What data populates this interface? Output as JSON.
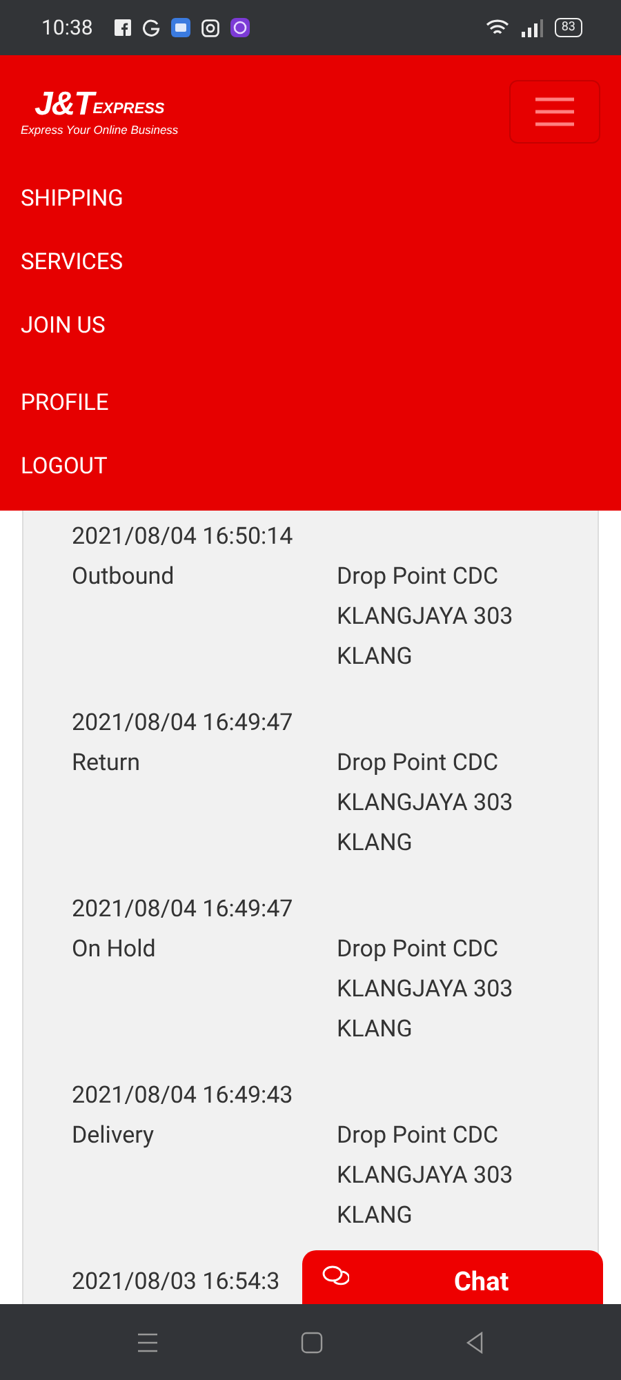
{
  "status_bar": {
    "time": "10:38",
    "battery": "83"
  },
  "header": {
    "logo": {
      "brand": "J&T",
      "suffix": "EXPRESS",
      "tagline": "Express Your Online Business"
    }
  },
  "nav_groups": [
    [
      "SHIPPING",
      "SERVICES",
      "JOIN US"
    ],
    [
      "PROFILE",
      "LOGOUT"
    ]
  ],
  "tracking": [
    {
      "datetime": "2021/08/04 16:50:14",
      "status": "Outbound",
      "location": "Drop Point CDC KLANGJAYA 303 KLANG"
    },
    {
      "datetime": "2021/08/04 16:49:47",
      "status": "Return",
      "location": "Drop Point CDC KLANGJAYA 303 KLANG"
    },
    {
      "datetime": "2021/08/04 16:49:47",
      "status": "On Hold",
      "location": "Drop Point CDC KLANGJAYA 303 KLANG"
    },
    {
      "datetime": "2021/08/04 16:49:43",
      "status": "Delivery",
      "location": "Drop Point CDC KLANGJAYA 303 KLANG"
    },
    {
      "datetime": "2021/08/03 16:54:3"
    }
  ],
  "chat_button": {
    "label": "Chat"
  }
}
